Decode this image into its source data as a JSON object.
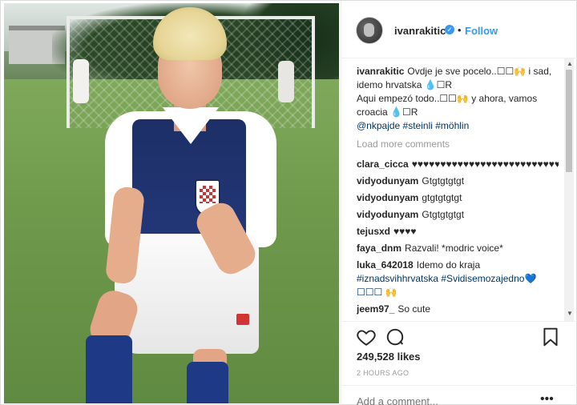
{
  "header": {
    "username": "ivanrakitic",
    "follow_label": "Follow",
    "separator": "•",
    "verified_glyph": "✓"
  },
  "caption": {
    "user": "ivanrakitic",
    "line1": "Ovdje je sve pocelo..☐☐🙌 i sad, idemo hrvatska 💧☐R",
    "line2": "Aqui empezó todo..☐☐🙌 y ahora, vamos croacia 💧☐R",
    "tags": "@nkpajde #steinli #möhlin"
  },
  "load_more": "Load more comments",
  "comments": [
    {
      "user": "clara_cicca",
      "text": "♥♥♥♥♥♥♥♥♥♥♥♥♥♥♥♥♥♥♥♥♥♥♥♥♥♥"
    },
    {
      "user": "vidyodunyam",
      "text": "Gtgtgtgtgt"
    },
    {
      "user": "vidyodunyam",
      "text": "gtgtgtgtgt"
    },
    {
      "user": "vidyodunyam",
      "text": "Gtgtgtgtgt"
    },
    {
      "user": "tejusxd",
      "text": "♥♥♥♥"
    },
    {
      "user": "faya_dnm",
      "text": "Razvali! *modric voice*"
    },
    {
      "user": "luka_642018",
      "text": "Idemo do kraja",
      "tags": "#iznadsvihhrvatska #Svidisemozajedno💙 ☐☐☐ 🙌"
    },
    {
      "user": "jeem97_",
      "text": "So cute"
    }
  ],
  "likes": "249,528 likes",
  "timestamp": "2 HOURS AGO",
  "add_comment": {
    "placeholder": "Add a comment..."
  },
  "more_glyph": "•••",
  "scrollbar": {
    "up": "▲",
    "down": "▼"
  },
  "icons": {
    "like": "heart-icon",
    "comment": "comment-icon",
    "save": "bookmark-icon"
  },
  "colors": {
    "accent": "#3897f0",
    "hashtag": "#003569",
    "muted": "#999999"
  }
}
